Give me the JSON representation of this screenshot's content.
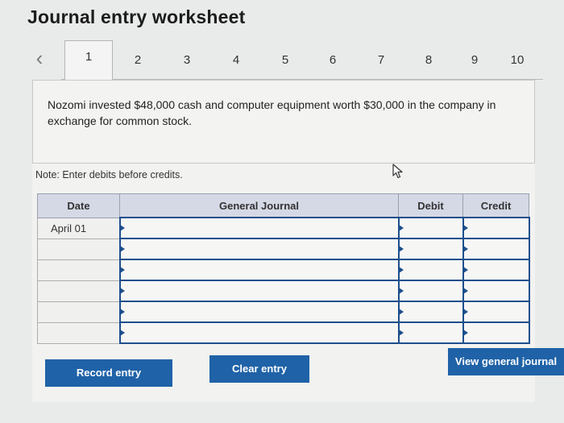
{
  "header": {
    "title": "Journal entry worksheet"
  },
  "tabs": {
    "prev_icon": "chevron-left-icon",
    "items": [
      {
        "label": "1",
        "active": true
      },
      {
        "label": "2"
      },
      {
        "label": "3"
      },
      {
        "label": "4"
      },
      {
        "label": "5"
      },
      {
        "label": "6"
      },
      {
        "label": "7"
      },
      {
        "label": "8"
      },
      {
        "label": "9"
      },
      {
        "label": "10"
      }
    ]
  },
  "question": {
    "text": "Nozomi invested $48,000 cash and computer equipment worth $30,000 in the company in exchange for common stock."
  },
  "note": {
    "text": "Note: Enter debits before credits."
  },
  "journal": {
    "headers": {
      "date": "Date",
      "general_journal": "General Journal",
      "debit": "Debit",
      "credit": "Credit"
    },
    "rows": [
      {
        "date": "April 01",
        "account": "",
        "debit": "",
        "credit": ""
      },
      {
        "date": "",
        "account": "",
        "debit": "",
        "credit": ""
      },
      {
        "date": "",
        "account": "",
        "debit": "",
        "credit": ""
      },
      {
        "date": "",
        "account": "",
        "debit": "",
        "credit": ""
      },
      {
        "date": "",
        "account": "",
        "debit": "",
        "credit": ""
      },
      {
        "date": "",
        "account": "",
        "debit": "",
        "credit": ""
      }
    ]
  },
  "buttons": {
    "record": "Record entry",
    "clear": "Clear entry",
    "view": "View general journal"
  },
  "colors": {
    "button_bg": "#1f62a7",
    "input_border": "#1e4f8c",
    "header_bg": "#d5d9e6"
  }
}
